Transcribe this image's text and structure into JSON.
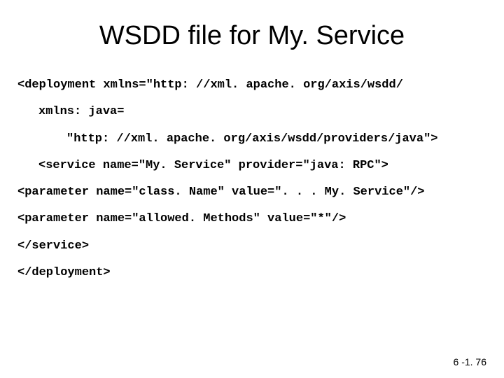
{
  "slide": {
    "title": "WSDD file for My. Service",
    "code": {
      "line1": "<deployment xmlns=\"http: //xml. apache. org/axis/wsdd/",
      "line2": "xmlns: java=",
      "line3": "\"http: //xml. apache. org/axis/wsdd/providers/java\">",
      "line4": "<service name=\"My. Service\" provider=\"java: RPC\">",
      "line5": "<parameter name=\"class. Name\" value=\". . . My. Service\"/>",
      "line6": "<parameter name=\"allowed. Methods\" value=\"*\"/>",
      "line7": "</service>",
      "line8": "</deployment>"
    },
    "page_number": "6 -1. 76"
  }
}
